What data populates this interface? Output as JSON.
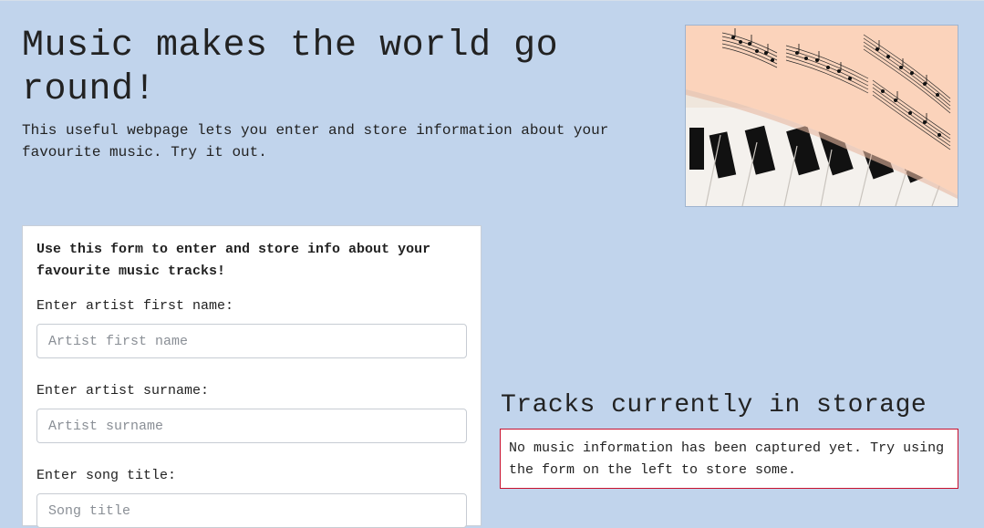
{
  "header": {
    "title": "Music makes the world go round!",
    "intro": "This useful webpage lets you enter and store information about your favourite music. Try it out."
  },
  "hero": {
    "image_alt": "Sheet music resting on piano keys"
  },
  "form": {
    "intro": "Use this form to enter and store info about your favourite music tracks!",
    "fields": [
      {
        "label": "Enter artist first name:",
        "placeholder": "Artist first name",
        "value": ""
      },
      {
        "label": "Enter artist surname:",
        "placeholder": "Artist surname",
        "value": ""
      },
      {
        "label": "Enter song title:",
        "placeholder": "Song title",
        "value": ""
      }
    ]
  },
  "storage": {
    "heading": "Tracks currently in storage",
    "empty_message": "No music information has been captured yet. Try using the form on the left to store some.",
    "border_color": "#c8102e"
  },
  "colors": {
    "page_background": "#c1d4ec",
    "panel_background": "#ffffff"
  }
}
